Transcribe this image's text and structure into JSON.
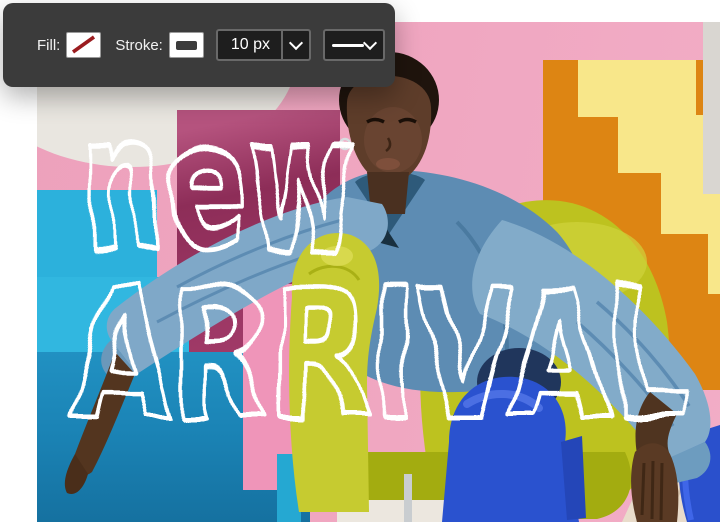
{
  "toolbar": {
    "fill_label": "Fill:",
    "stroke_label": "Stroke:",
    "fill_swatch": {
      "type": "none",
      "slash_color": "#9b1c1f"
    },
    "stroke_swatch": {
      "preview_color": "#3b3b3b"
    },
    "stroke_width_value": "10 px",
    "stroke_style_selected": "solid-line",
    "background": "#3b3b3b"
  },
  "overlay_text": {
    "line1": "new",
    "line2": "ARRIVAL",
    "color": "#ffffff"
  },
  "photo": {
    "description": "Model in a light denim jacket and cobalt blue boots reclining on a chartreuse chair among colorful geometric blocks and yellow stairs",
    "palette": {
      "pink_wall": "#efa2bd",
      "magenta_block": "#a63e6c",
      "cyan_block": "#2cb1dc",
      "blue_step": "#1b84b6",
      "pink_box": "#ef95b9",
      "orange_block": "#dd8513",
      "yellow_steps": "#f8e78a",
      "chartreuse_chair": "#c2c72c",
      "denim_jacket": "#6f9cc0",
      "cobalt_boots": "#2a52cf",
      "skin_tone": "#553722",
      "cream_oval": "#e9e6e0",
      "floor_tile": "#e9dccb"
    }
  }
}
